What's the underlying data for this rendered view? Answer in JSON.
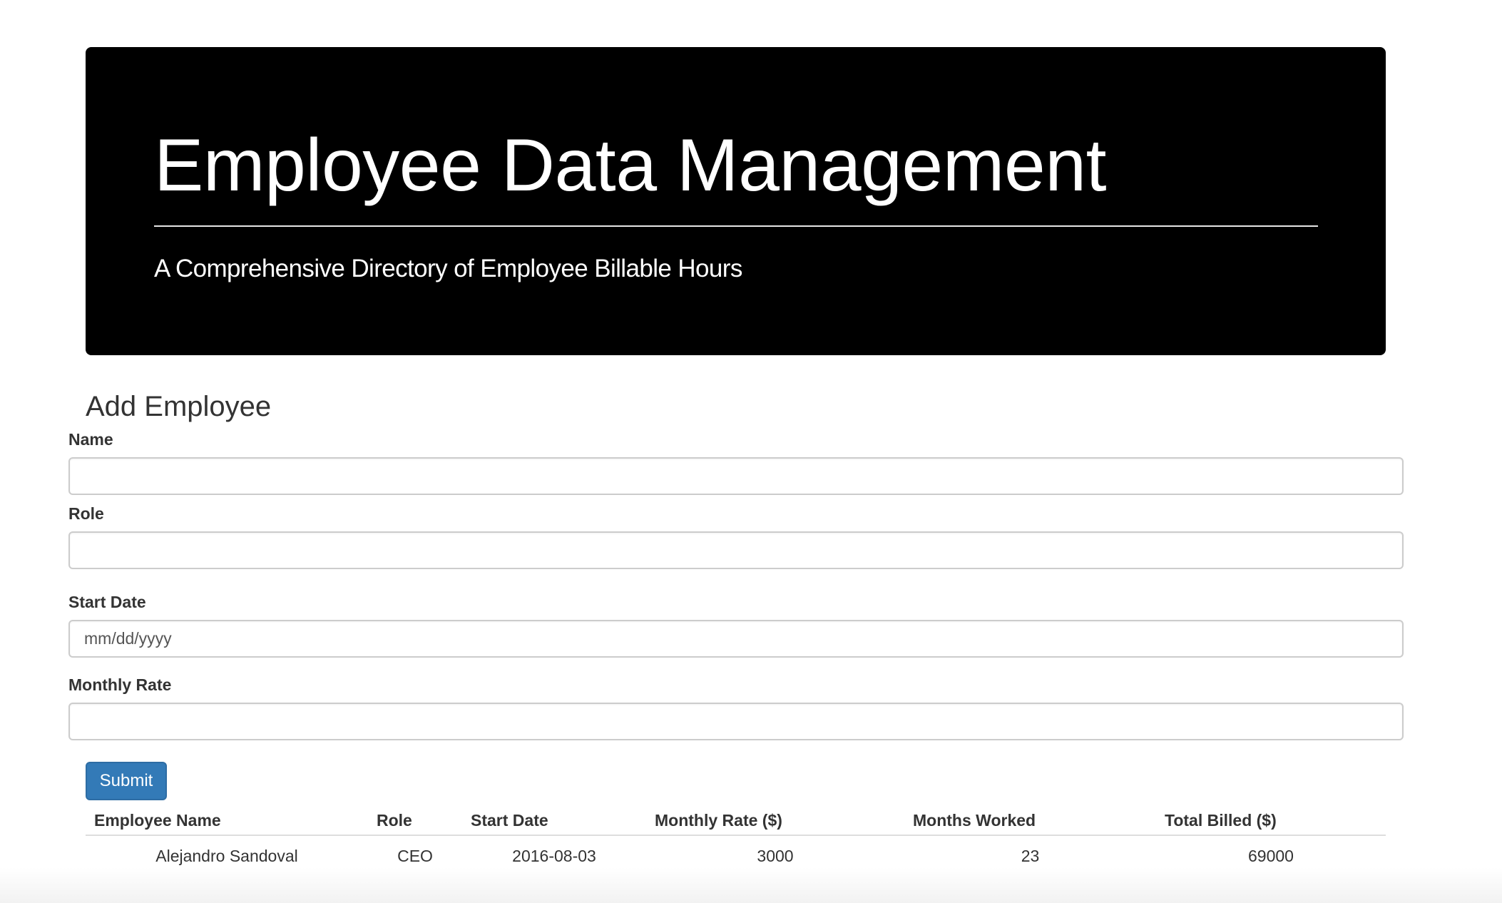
{
  "header": {
    "title": "Employee Data Management",
    "subtitle": "A Comprehensive Directory of Employee Billable Hours"
  },
  "form": {
    "heading": "Add Employee",
    "fields": [
      {
        "label": "Name",
        "value": "",
        "placeholder": ""
      },
      {
        "label": "Role",
        "value": "",
        "placeholder": ""
      },
      {
        "label": "Start Date",
        "value": "",
        "placeholder": "mm/dd/yyyy"
      },
      {
        "label": "Monthly Rate",
        "value": "",
        "placeholder": ""
      }
    ],
    "submit_label": "Submit"
  },
  "table": {
    "columns": [
      "Employee Name",
      "Role",
      "Start Date",
      "Monthly Rate ($)",
      "Months Worked",
      "Total Billed ($)"
    ],
    "rows": [
      [
        "Alejandro Sandoval",
        "CEO",
        "2016-08-03",
        "3000",
        "23",
        "69000"
      ]
    ]
  },
  "colors": {
    "jumbotron_bg": "#000000",
    "primary_button": "#337ab7"
  }
}
